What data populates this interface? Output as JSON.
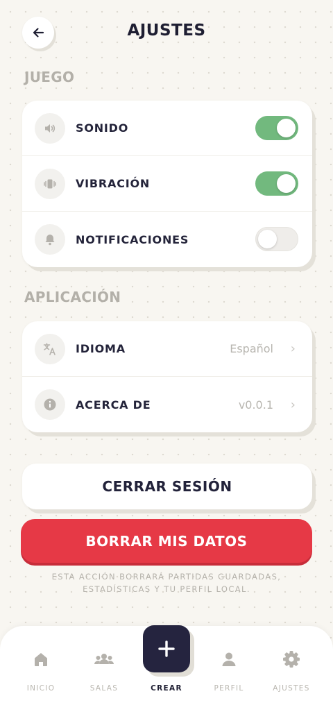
{
  "header": {
    "title": "AJUSTES",
    "back_icon": "arrow-left-icon"
  },
  "sections": {
    "game": {
      "label": "JUEGO",
      "items": [
        {
          "label": "SONIDO",
          "icon": "volume-icon",
          "toggle": true
        },
        {
          "label": "VIBRACIÓN",
          "icon": "vibration-icon",
          "toggle": true
        },
        {
          "label": "NOTIFICACIONES",
          "icon": "bell-icon",
          "toggle": false
        }
      ]
    },
    "app": {
      "label": "APLICACIÓN",
      "items": [
        {
          "label": "IDIOMA",
          "icon": "translate-icon",
          "value": "Español"
        },
        {
          "label": "ACERCA DE",
          "icon": "info-icon",
          "value": "v0.0.1"
        }
      ]
    }
  },
  "actions": {
    "logout_label": "CERRAR SESIÓN",
    "delete_label": "BORRAR MIS DATOS",
    "warning_line1": "ESTA ACCIÓN BORRARÁ PARTIDAS GUARDADAS,",
    "warning_line2": "ESTADÍSTICAS Y TU PERFIL LOCAL."
  },
  "nav": {
    "items": [
      {
        "label": "INICIO",
        "icon": "home-icon"
      },
      {
        "label": "SALAS",
        "icon": "group-icon"
      },
      {
        "label": "CREAR",
        "icon": "plus-icon",
        "active": true
      },
      {
        "label": "PERFIL",
        "icon": "person-icon"
      },
      {
        "label": "AJUSTES",
        "icon": "gear-icon"
      }
    ]
  },
  "colors": {
    "toggle_on": "#72b97e",
    "danger": "#e63946",
    "primary_dark": "#25243f",
    "background": "#f8f6f1"
  }
}
